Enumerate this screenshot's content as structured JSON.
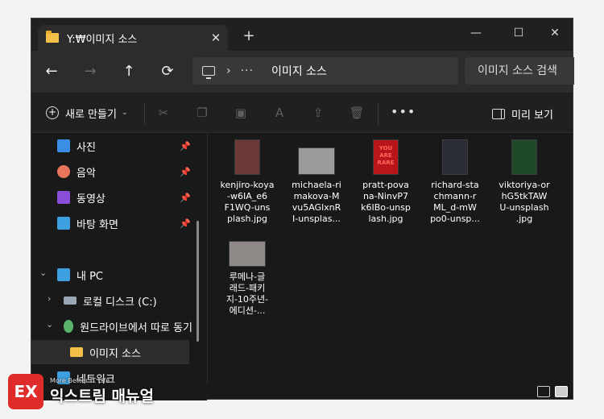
{
  "window": {
    "tab_title": "Y:₩이미지 소스",
    "tab_close": "✕",
    "new_tab": "+",
    "minimize": "—",
    "maximize": "☐",
    "close": "✕"
  },
  "address": {
    "back": "←",
    "forward": "→",
    "up": "↑",
    "refresh": "⟳",
    "chevron": "›",
    "overflow": "···",
    "current_folder": "이미지 소스",
    "search_placeholder": "이미지 소스 검색"
  },
  "commands": {
    "new_label": "새로 만들기",
    "new_plus": "+",
    "caret": "⌄",
    "cut": "✂",
    "copy": "❐",
    "paste": "▣",
    "rename": "A",
    "share": "⇪",
    "delete": "🗑",
    "more": "•••",
    "preview_label": "미리 보기"
  },
  "sidebar": {
    "pin": "📌",
    "items": [
      {
        "label": "사진",
        "icon": "photos-icon",
        "color": "#3a8ee6",
        "pinned": true
      },
      {
        "label": "음악",
        "icon": "music-icon",
        "color": "#e8745a",
        "pinned": true
      },
      {
        "label": "동영상",
        "icon": "videos-icon",
        "color": "#8a4fd8",
        "pinned": true
      },
      {
        "label": "바탕 화면",
        "icon": "desktop-icon",
        "color": "#3ea0e0",
        "pinned": true
      },
      {
        "label": "내 PC",
        "icon": "this-pc-icon",
        "color": "#3ea0e0",
        "expanded": true
      },
      {
        "label": "로컬 디스크 (C:)",
        "icon": "drive-icon",
        "color": "#9aa7b5"
      },
      {
        "label": "원드라이브에서 따로 동기",
        "icon": "network-drive-icon",
        "color": "#59b36b",
        "expanded": true
      },
      {
        "label": "이미지 소스",
        "icon": "folder-icon",
        "color": "#f5c04a",
        "selected": true
      },
      {
        "label": "네트워크",
        "icon": "network-icon",
        "color": "#3ea0e0"
      }
    ],
    "expand_chevron": "⌄",
    "collapsed_chevron": "›"
  },
  "files": [
    {
      "name": "kenjiro-koya-w6IA_e6F1WQ-unsplash.jpg",
      "lines": [
        "kenjiro-koya",
        "-w6IA_e6",
        "F1WQ-uns",
        "plash.jpg"
      ],
      "thumb_color": "#6b3a36"
    },
    {
      "name": "michaela-rimakova-Mvu5AGlxnRI-unsplash",
      "lines": [
        "michaela-ri",
        "makova-M",
        "vu5AGlxnR",
        "I-unsplas..."
      ],
      "thumb_color": "#9a9c9a"
    },
    {
      "name": "pratt-povana-NinvP7k6IBo-unsplash.jpg",
      "lines": [
        "pratt-pova",
        "na-NinvP7",
        "k6IBo-unsp",
        "lash.jpg"
      ],
      "thumb_color": "#b8161a",
      "thumb_text": "YOU ARE RARE"
    },
    {
      "name": "richard-stachmann-rML_d-mWpo0-unsplash",
      "lines": [
        "richard-sta",
        "chmann-r",
        "ML_d-mW",
        "po0-unsp..."
      ],
      "thumb_color": "#2a2d35"
    },
    {
      "name": "viktoriya-orhG5tkTAWU-unsplash.jpg",
      "lines": [
        "viktoriya-or",
        "hG5tkTAW",
        "U-unsplash",
        ".jpg"
      ],
      "thumb_color": "#1f4a2a"
    },
    {
      "name": "루메나-글래드-패키지-10주년-에디션-",
      "lines": [
        "루메나-글",
        "래드-패키",
        "지-10주년-",
        "에디션-..."
      ],
      "thumb_color": "#8f8a88"
    }
  ],
  "logo": {
    "mark": "EX",
    "subtitle": "More Better IT Life",
    "title": "익스트림 매뉴얼"
  }
}
